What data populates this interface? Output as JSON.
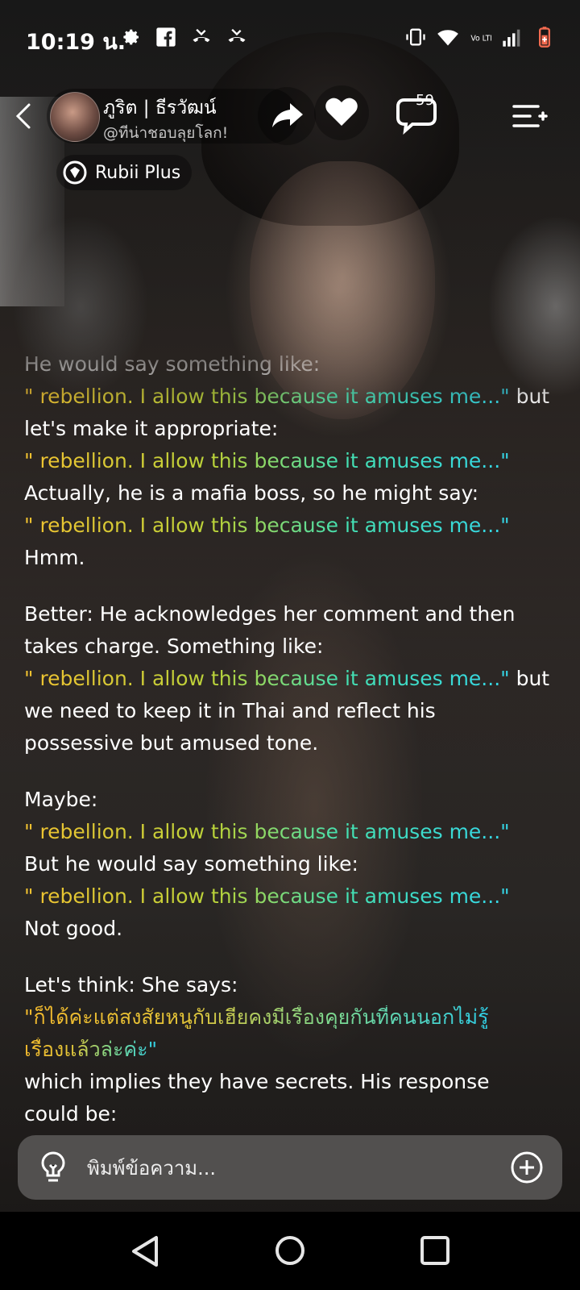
{
  "status_bar": {
    "time": "10:19 น.",
    "left_icons": [
      "gear-icon",
      "facebook-icon",
      "missed-call-icon",
      "missed-call-icon"
    ],
    "right_icons": [
      "vibrate-icon",
      "wifi-icon",
      "volte-icon",
      "signal-icon",
      "battery-icon"
    ],
    "volte_text": "Vo LTE"
  },
  "header": {
    "character_name": "ภูริต | ธีรวัฒน์",
    "handle": "@ทีน่าชอบลุยโลก!",
    "comment_count": "59"
  },
  "badge": {
    "label": "Rubii Plus"
  },
  "chat": {
    "lines": {
      "l1": "He would say something like:",
      "l2_quote": "\" rebellion. I allow this because it amuses me...\"",
      "l2_tail": " but",
      "l3": "let's make it appropriate:",
      "l4_quote": "\" rebellion. I allow this because it amuses me...\"",
      "l5": "Actually, he is a mafia boss, so he might say:",
      "l6_quote": "\" rebellion. I allow this because it amuses me...\"",
      "l7": "Hmm.",
      "l8": "Better: He acknowledges her comment and then",
      "l9": "takes charge. Something like:",
      "l10_quote": "\" rebellion. I allow this because it amuses me...\"",
      "l10_tail": " but",
      "l11": "we need to keep it in Thai and reflect his",
      "l12": "possessive but amused tone.",
      "l13": "Maybe:",
      "l14_quote": "\" rebellion. I allow this because it amuses me...\"",
      "l15": "But he would say something like:",
      "l16_quote": "\" rebellion. I allow this because it amuses me...\"",
      "l17": "Not good.",
      "l18": "Let's think: She says:",
      "l19_quote": "\"ก็ได้ค่ะแต่สงสัยหนูกับเฮียคงมีเรื่องคุยกันที่คนนอกไม่รู้",
      "l20_quote": "เรื่องแล้วล่ะค่ะ\"",
      "l21": "which implies they have secrets. His response",
      "l22": "could be:"
    }
  },
  "composer": {
    "placeholder": "พิมพ์ข้อความ..."
  },
  "colors": {
    "quote_start": "#f2c230",
    "quote_end": "#34d6e8",
    "input_bg": "#5a5856"
  }
}
